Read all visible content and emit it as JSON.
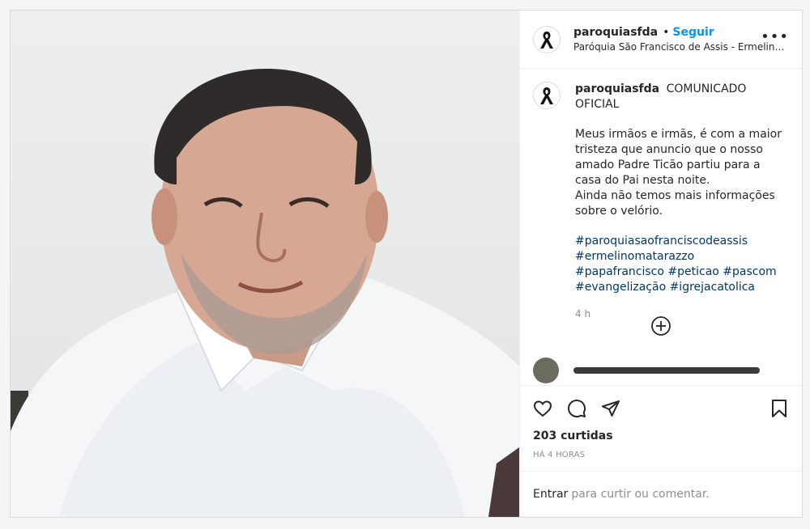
{
  "post": {
    "username": "paroquiasfda",
    "follow_label": "Seguir",
    "separator": "•",
    "location": "Paróquia São Francisco de Assis - Ermelino M...",
    "more_label": "•••",
    "avatar_icon": "mourning-ribbon-icon",
    "caption": {
      "title": "COMUNICADO OFICIAL",
      "lines": [
        "Meus irmãos e irmãs, é com a maior tristeza que anuncio que o nosso amado Padre Ticão partiu para a casa do Pai nesta noite.",
        "Ainda não temos mais informações sobre o velório."
      ],
      "hashtags": "#paroquiasaofranciscodeassis #ermelinomatarazzo #papafrancisco #peticao #pascom #evangelização #igrejacatolica",
      "time": "4 h"
    },
    "likes": "203 curtidas",
    "time_ago": "HÁ 4 HORAS",
    "comment_box": {
      "login_label": "Entrar",
      "rest_label": "para curtir ou comentar."
    }
  },
  "icons": {
    "like": "heart-icon",
    "comment": "comment-bubble-icon",
    "share": "paper-plane-icon",
    "save": "bookmark-icon",
    "load_more": "plus-circle-icon"
  },
  "colors": {
    "accent": "#0095f6",
    "hashtag": "#00376b",
    "muted": "#8e8e8e",
    "text": "#262626"
  }
}
